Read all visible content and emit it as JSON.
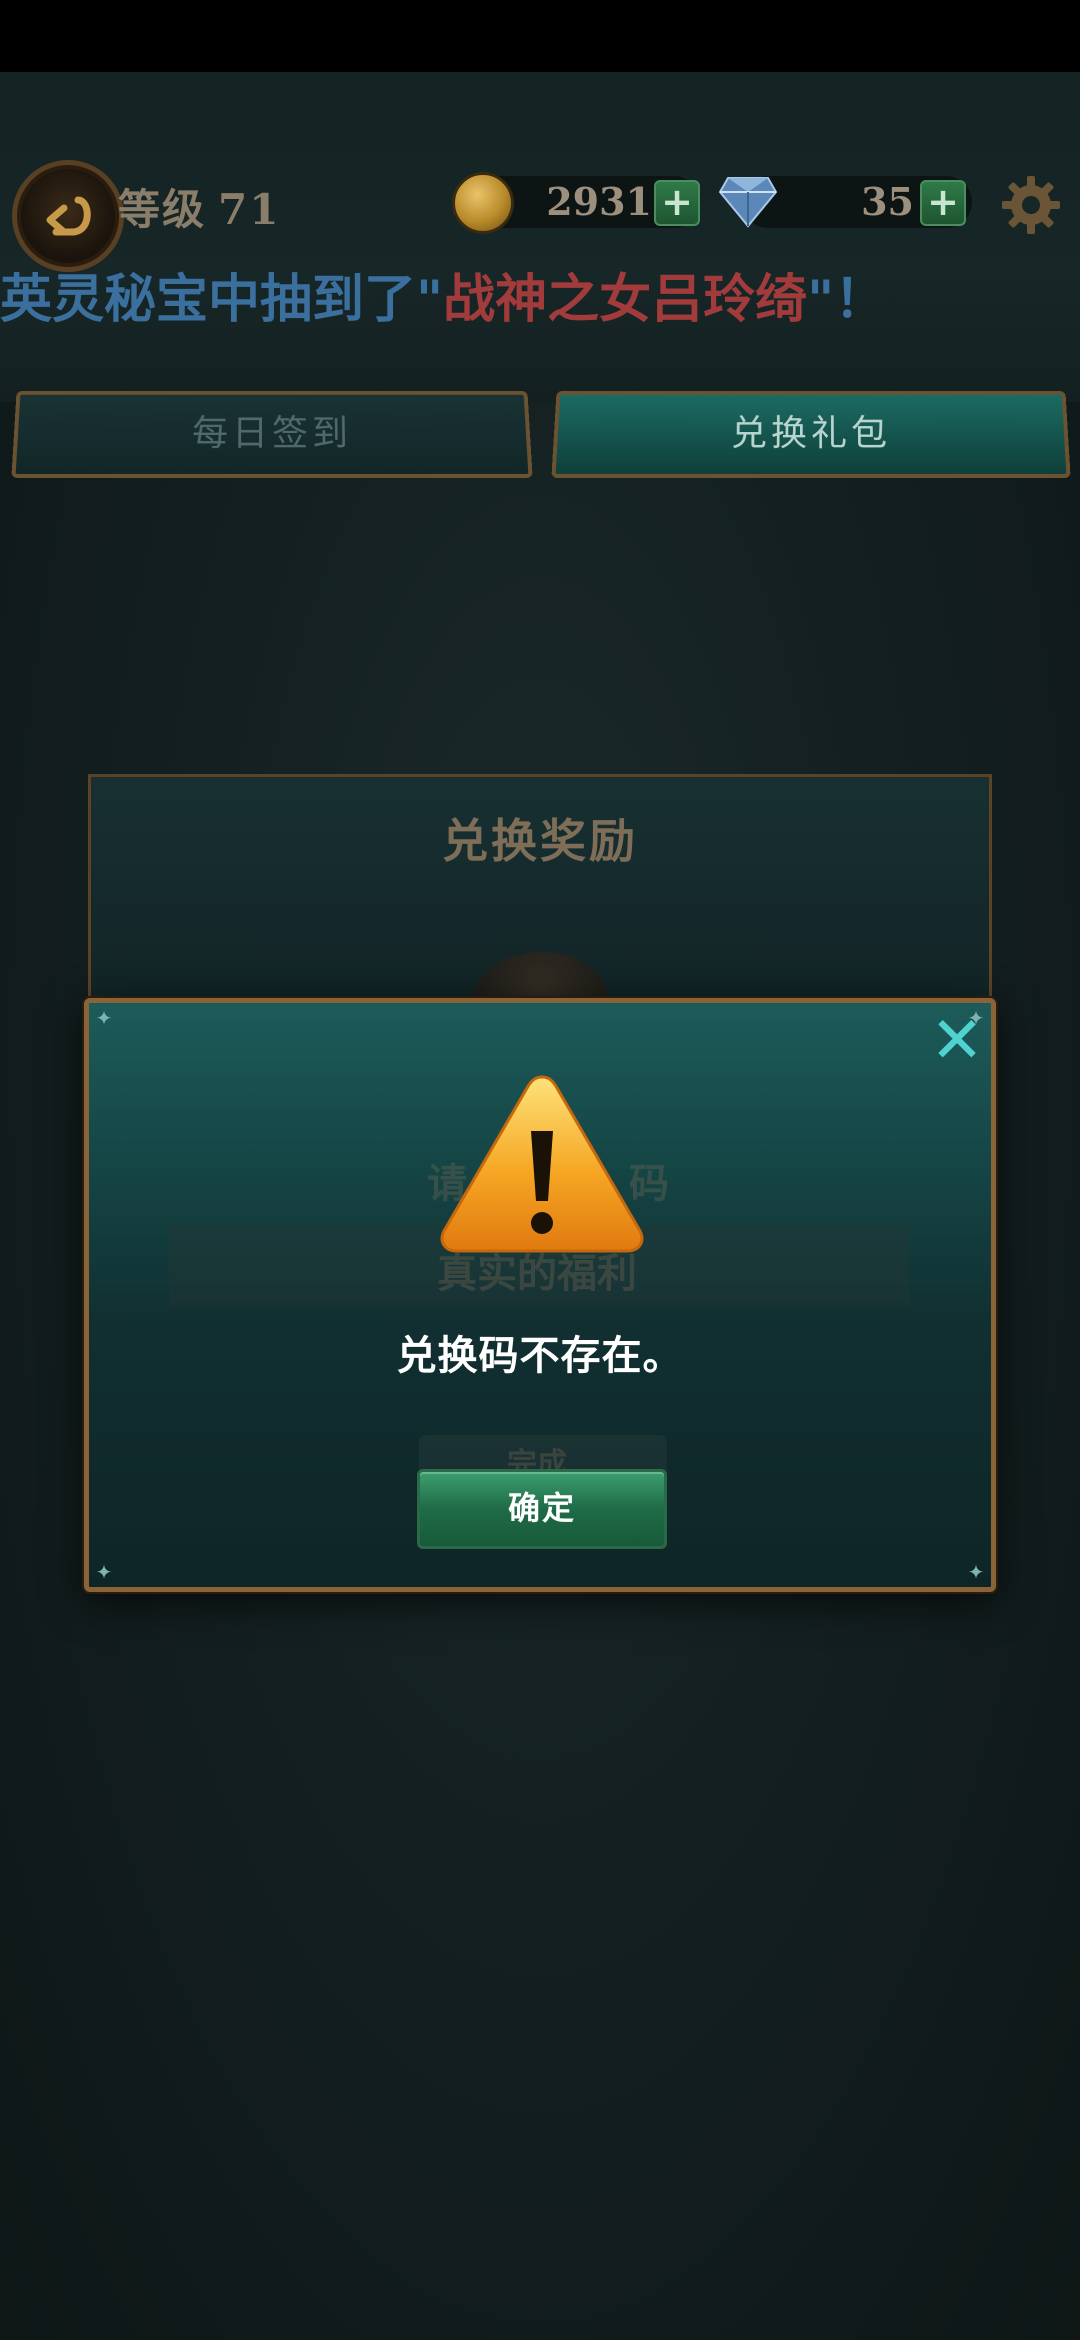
{
  "hud": {
    "level_label": "等级",
    "level_value": "71",
    "coins": "2931",
    "gems": "35",
    "plus_symbol": "+",
    "back_icon": "back-arrow-icon",
    "gear_icon": "gear-icon"
  },
  "marquee": {
    "prefix": "英灵秘宝中抽到了\"",
    "highlight": "战神之女吕玲绮",
    "suffix": "\"！"
  },
  "tabs": [
    {
      "label": "每日签到",
      "active": false
    },
    {
      "label": "兑换礼包",
      "active": true
    }
  ],
  "background_panel": {
    "title": "兑换奖励",
    "hint_partial_left": "请",
    "hint_partial_right": "码",
    "input_placeholder": "真实的福利",
    "button_partial": "完成"
  },
  "dialog": {
    "icon": "warning-triangle-icon",
    "message": "兑换码不存在。",
    "confirm_label": "确定",
    "close_icon": "close-icon"
  },
  "colors": {
    "accent_teal": "#4fd3d0",
    "frame_bronze": "#8a6336",
    "confirm_green": "#1f6b47",
    "marquee_red": "#a23b3b",
    "marquee_blue": "#3a6f9e"
  }
}
